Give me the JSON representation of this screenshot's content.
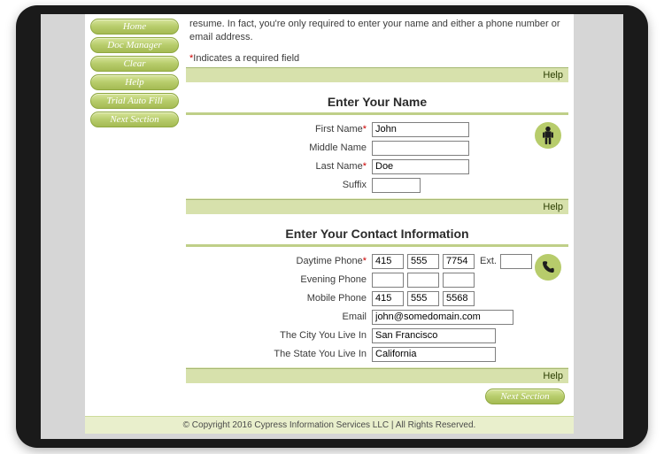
{
  "sidebar": {
    "items": [
      {
        "label": "Home"
      },
      {
        "label": "Doc Manager"
      },
      {
        "label": "Clear"
      },
      {
        "label": "Help"
      },
      {
        "label": "Trial Auto Fill"
      },
      {
        "label": "Next Section"
      }
    ]
  },
  "intro": {
    "partial_top": "",
    "line2": "resume. In fact, you're only required to enter your name and either a phone number or email address.",
    "required_prefix": "*",
    "required_text": "Indicates a required field"
  },
  "help_label": "Help",
  "name_section": {
    "title": "Enter Your Name",
    "first_label": "First Name",
    "first_value": "John",
    "middle_label": "Middle Name",
    "middle_value": "",
    "last_label": "Last Name",
    "last_value": "Doe",
    "suffix_label": "Suffix",
    "suffix_value": ""
  },
  "contact_section": {
    "title": "Enter Your Contact Information",
    "daytime_label": "Daytime Phone",
    "evening_label": "Evening Phone",
    "mobile_label": "Mobile Phone",
    "ext_label": "Ext.",
    "email_label": "Email",
    "city_label": "The City You Live In",
    "state_label": "The State You Live In",
    "daytime": {
      "a": "415",
      "b": "555",
      "c": "7754",
      "ext": ""
    },
    "evening": {
      "a": "",
      "b": "",
      "c": ""
    },
    "mobile": {
      "a": "415",
      "b": "555",
      "c": "5568"
    },
    "email_value": "john@somedomain.com",
    "city_value": "San Francisco",
    "state_value": "California"
  },
  "actions": {
    "next_label": "Next Section"
  },
  "footer": {
    "text": "© Copyright 2016 Cypress Information Services LLC |  All Rights Reserved."
  }
}
